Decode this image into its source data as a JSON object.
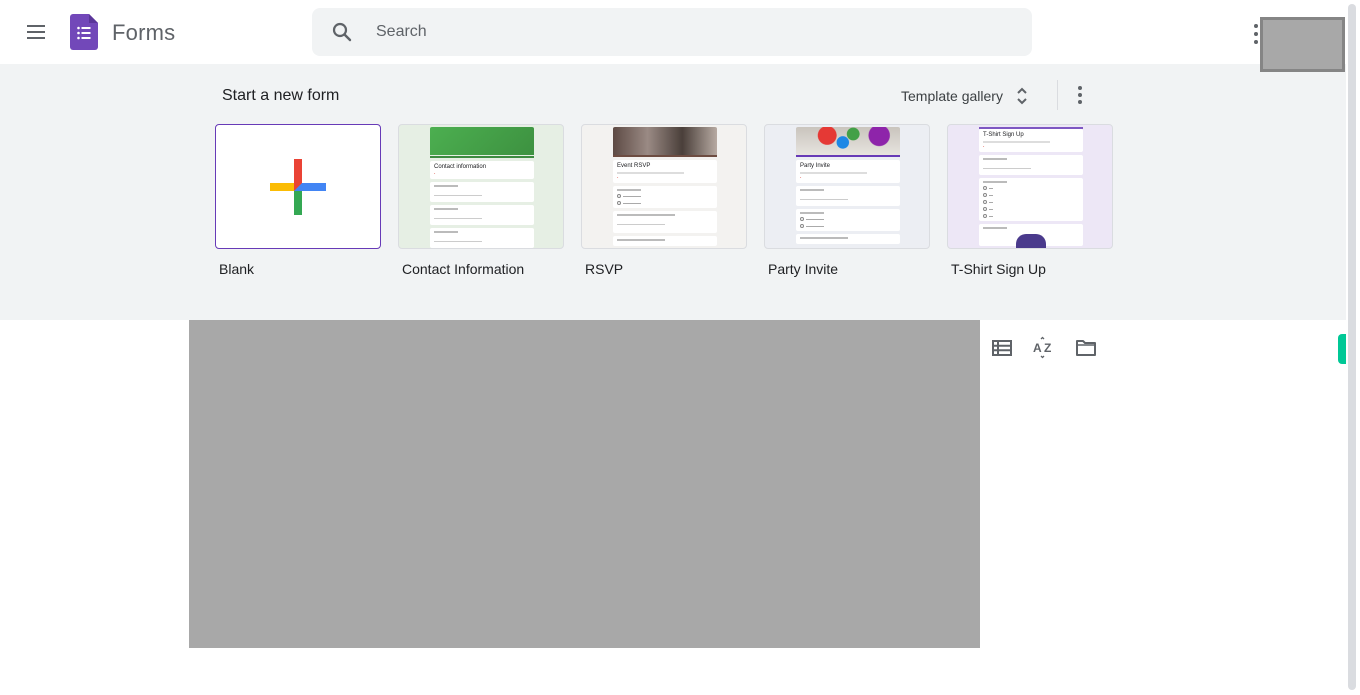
{
  "header": {
    "app_title": "Forms",
    "search_placeholder": "Search",
    "search_value": "",
    "icons": [
      "main-menu-icon",
      "forms-logo-icon",
      "search-icon",
      "apps-icon"
    ],
    "account": "redacted"
  },
  "templates": {
    "section_title": "Start a new form",
    "gallery_label": "Template gallery",
    "tiles": [
      {
        "label": "Blank",
        "preview_title": ""
      },
      {
        "label": "Contact Information",
        "preview_title": "Contact information"
      },
      {
        "label": "RSVP",
        "preview_title": "Event RSVP"
      },
      {
        "label": "Party Invite",
        "preview_title": "Party Invite"
      },
      {
        "label": "T-Shirt Sign Up",
        "preview_title": "T-Shirt Sign Up"
      }
    ],
    "colors": {
      "contact": "#43a047",
      "rsvp": "#6d4c41",
      "party": "#673ab7",
      "tshirt": "#7e57c2",
      "blank_border": "#673ab7"
    }
  },
  "recent": {
    "content": "redacted",
    "view_icons": [
      "list-view-icon",
      "sort-az-icon",
      "folder-icon"
    ]
  }
}
